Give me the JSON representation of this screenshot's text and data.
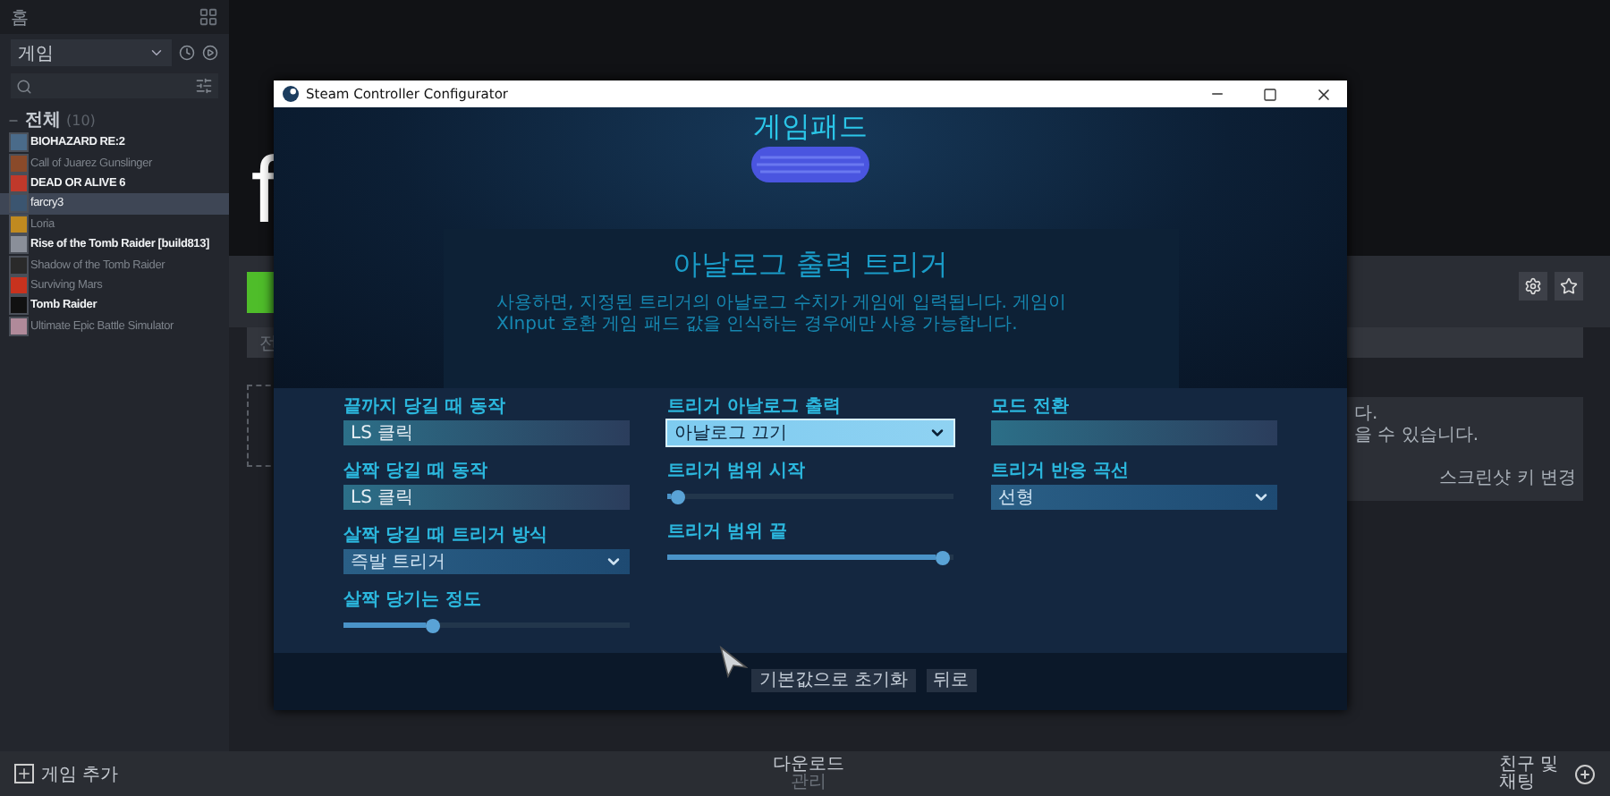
{
  "sidebar": {
    "home": "홈",
    "filter": "게임",
    "category": {
      "label": "전체",
      "count": "(10)",
      "expanded": true
    },
    "games": [
      {
        "name": "BIOHAZARD RE:2",
        "installed": true,
        "selected": false,
        "color": "#4a6b8a"
      },
      {
        "name": "Call of Juarez Gunslinger",
        "installed": false,
        "selected": false,
        "color": "#8a4a2a"
      },
      {
        "name": "DEAD OR ALIVE 6",
        "installed": true,
        "selected": false,
        "color": "#c0392b"
      },
      {
        "name": "farcry3",
        "installed": true,
        "selected": true,
        "color": "#3b5570"
      },
      {
        "name": "Loria",
        "installed": false,
        "selected": false,
        "color": "#c08a20"
      },
      {
        "name": "Rise of the Tomb Raider [build813]",
        "installed": true,
        "selected": false,
        "color": "#8a8f99"
      },
      {
        "name": "Shadow of the Tomb Raider",
        "installed": false,
        "selected": false,
        "color": "#2a2a2a"
      },
      {
        "name": "Surviving Mars",
        "installed": false,
        "selected": false,
        "color": "#c8321e"
      },
      {
        "name": "Tomb Raider",
        "installed": true,
        "selected": false,
        "color": "#111111"
      },
      {
        "name": "Ultimate Epic Battle Simulator",
        "installed": false,
        "selected": false,
        "color": "#b08a9a"
      }
    ]
  },
  "hero": {
    "title_fragment": "f"
  },
  "background": {
    "tab_fragment": "전",
    "notice_lines": [
      "다.",
      "을 수 있습니다."
    ],
    "link": "스크린샷 키 변경"
  },
  "dialog": {
    "title": "Steam Controller Configurator",
    "header": "게임패드",
    "section": {
      "title": "아날로그 출력 트리거",
      "description": "사용하면, 지정된 트리거의 아날로그 수치가 게임에 입력됩니다. 게임이 XInput 호환 게임 패드 값을 인식하는 경우에만 사용 가능합니다."
    },
    "columns": [
      [
        {
          "kind": "field",
          "label": "끝까지 당길 때 동작",
          "value": "LS 클릭"
        },
        {
          "kind": "field",
          "label": "살짝 당길 때 동작",
          "value": "LS 클릭"
        },
        {
          "kind": "dropdown",
          "label": "살짝 당길 때 트리거 방식",
          "value": "즉발 트리거",
          "highlighted": false
        },
        {
          "kind": "slider",
          "label": "살짝 당기는 정도",
          "level": 0.31
        }
      ],
      [
        {
          "kind": "dropdown",
          "label": "트리거 아날로그 출력",
          "value": "아날로그 끄기",
          "highlighted": true
        },
        {
          "kind": "slider",
          "label": "트리거 범위 시작",
          "level": 0.04
        },
        {
          "kind": "slider",
          "label": "트리거 범위 끝",
          "level": 0.96
        }
      ],
      [
        {
          "kind": "field",
          "label": "모드 전환"
        },
        {
          "kind": "dropdown",
          "label": "트리거 반응 곡선",
          "value": "선형",
          "highlighted": false
        }
      ]
    ],
    "buttons": [
      "기본값으로 초기화",
      "뒤로"
    ]
  },
  "bottom_bar": {
    "add_game": "게임 추가",
    "downloads": "다운로드",
    "downloads_status": "관리",
    "friends": "친구 및 채팅"
  }
}
